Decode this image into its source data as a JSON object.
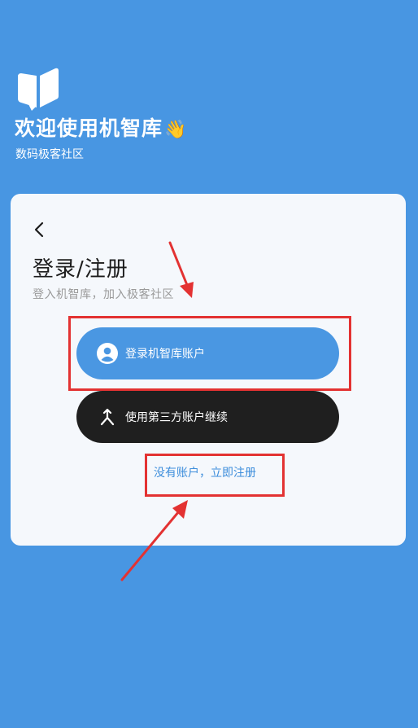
{
  "header": {
    "welcome_text": "欢迎使用机智库",
    "wave_emoji": "👋",
    "subtitle": "数码极客社区"
  },
  "card": {
    "title": "登录/注册",
    "description": "登入机智库，加入极客社区",
    "login_button_label": "登录机智库账户",
    "third_party_button_label": "使用第三方账户继续",
    "register_link": "没有账户，立即注册"
  },
  "icons": {
    "logo": "book-logo-icon",
    "back": "chevron-left-icon",
    "login": "user-circle-icon",
    "third_party": "merge-arrow-icon"
  },
  "colors": {
    "background": "#4896E2",
    "card": "#F5F8FC",
    "primary_button": "#4A97E2",
    "dark_button": "#1F1F1F",
    "link": "#3C8DDB",
    "annotation": "#E33232"
  }
}
